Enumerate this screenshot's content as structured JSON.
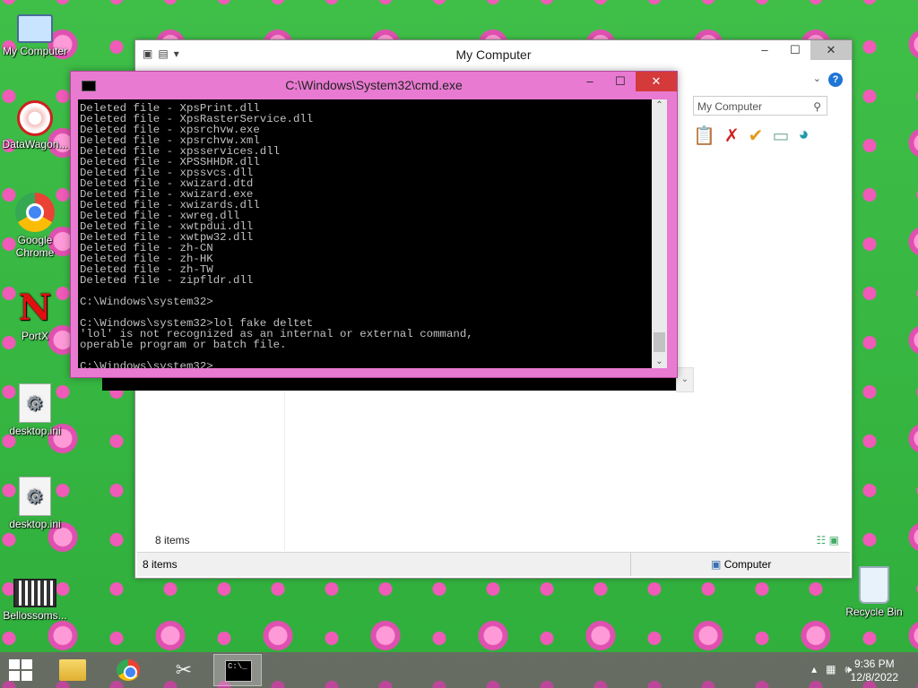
{
  "desktop": {
    "icons": [
      {
        "label": "My Computer"
      },
      {
        "label": "DataWagon..."
      },
      {
        "label": "Google Chrome"
      },
      {
        "label": "PortX"
      },
      {
        "label": "desktop.ini"
      },
      {
        "label": "desktop.ini"
      },
      {
        "label": "Bellossoms..."
      },
      {
        "label": "Recycle Bin"
      }
    ]
  },
  "explorer": {
    "title": "My Computer",
    "search_placeholder": "My Computer",
    "items_count_inner": "8 items",
    "status_left": "8 items",
    "status_right": "Computer"
  },
  "cmd": {
    "title": "C:\\Windows\\System32\\cmd.exe",
    "output": "Deleted file - XpsPrint.dll\nDeleted file - XpsRasterService.dll\nDeleted file - xpsrchvw.exe\nDeleted file - xpsrchvw.xml\nDeleted file - xpsservices.dll\nDeleted file - XPSSHHDR.dll\nDeleted file - xpssvcs.dll\nDeleted file - xwizard.dtd\nDeleted file - xwizard.exe\nDeleted file - xwizards.dll\nDeleted file - xwreg.dll\nDeleted file - xwtpdui.dll\nDeleted file - xwtpw32.dll\nDeleted file - zh-CN\nDeleted file - zh-HK\nDeleted file - zh-TW\nDeleted file - zipfldr.dll\n\nC:\\Windows\\system32>\n\nC:\\Windows\\system32>lol fake deltet\n'lol' is not recognized as an internal or external command,\noperable program or batch file.\n\nC:\\Windows\\system32>",
    "scroll_position": 0.92
  },
  "taskbar": {
    "clock_time": "9:36 PM",
    "clock_date": "12/8/2022",
    "apps": [
      {
        "name": "file-explorer"
      },
      {
        "name": "google-chrome"
      },
      {
        "name": "tool"
      },
      {
        "name": "command-prompt",
        "active": true
      }
    ]
  }
}
